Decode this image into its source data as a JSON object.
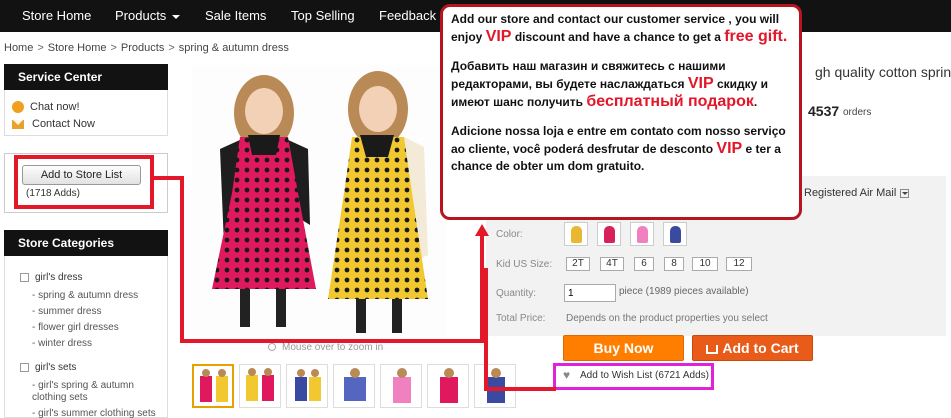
{
  "nav": {
    "items": [
      {
        "label": "Store Home"
      },
      {
        "label": "Products",
        "has_dropdown": true
      },
      {
        "label": "Sale Items"
      },
      {
        "label": "Top Selling"
      },
      {
        "label": "Feedback"
      }
    ]
  },
  "breadcrumb": [
    "Home",
    "Store Home",
    "Products",
    "spring & autumn dress"
  ],
  "breadcrumb_separator": ">",
  "service": {
    "title": "Service Center",
    "chat_label": "Chat now!",
    "contact_label": "Contact Now"
  },
  "store_list": {
    "button_label": "Add to Store List",
    "adds_count": "(1718 Adds)"
  },
  "categories": {
    "title": "Store Categories",
    "groups": [
      {
        "label": "girl's dress",
        "items": [
          "spring & autumn dress",
          "summer dress",
          "flower girl dresses",
          "winter dress"
        ]
      },
      {
        "label": "girl's sets",
        "items": [
          "girl's spring & autumn clothing sets",
          "girl's summer clothing sets"
        ]
      }
    ]
  },
  "product": {
    "title_fragment": "gh quality cotton spring",
    "orders_count": "4537",
    "orders_label": "orders",
    "zoom_hint": "Mouse over to zoom in",
    "thumbnail_count": 7,
    "shipping_method": "Registered Air Mail",
    "color_label": "Color:",
    "size_label": "Kid US Size:",
    "sizes": [
      "2T",
      "4T",
      "6",
      "8",
      "10",
      "12"
    ],
    "quantity_label": "Quantity:",
    "quantity_value": "1",
    "quantity_note": "piece (1989 pieces available)",
    "total_label": "Total Price:",
    "total_note": "Depends on the product properties you select",
    "buy_now_label": "Buy Now",
    "add_to_cart_label": "Add to Cart",
    "wish_label": "Add to Wish List (6721 Adds)"
  },
  "promo": {
    "en_1": "Add our store and contact our customer service , you will enjoy ",
    "en_vip": "VIP",
    "en_2": " discount and have a chance to get a ",
    "en_gift": "free gift.",
    "ru_1": "Добавить наш магазин и свяжитесь с нашими редакторами, вы будете наслаждаться ",
    "ru_vip": "VIP",
    "ru_2": " скидку и имеют шанс получить ",
    "ru_gift": "бесплатный подарок",
    "ru_3": ".",
    "pt_1": "Adicione nossa loja e entre em contato com nosso serviço ao cliente, você poderá desfrutar de desconto ",
    "pt_vip": "VIP",
    "pt_2": " e ter a chance de obter um dom gratuito."
  },
  "colors": {
    "nav_bg": "#121212",
    "accent_red": "#e3192a",
    "buy_orange": "#ff7e00",
    "cart_orange": "#e85b18",
    "wish_frame": "#e022d8",
    "pink_dress": "#e0195f",
    "yellow_dress": "#f2c830"
  },
  "swatch_colors": [
    "#e8b830",
    "#d8205a",
    "#f080c0",
    "#3a4aa0"
  ]
}
